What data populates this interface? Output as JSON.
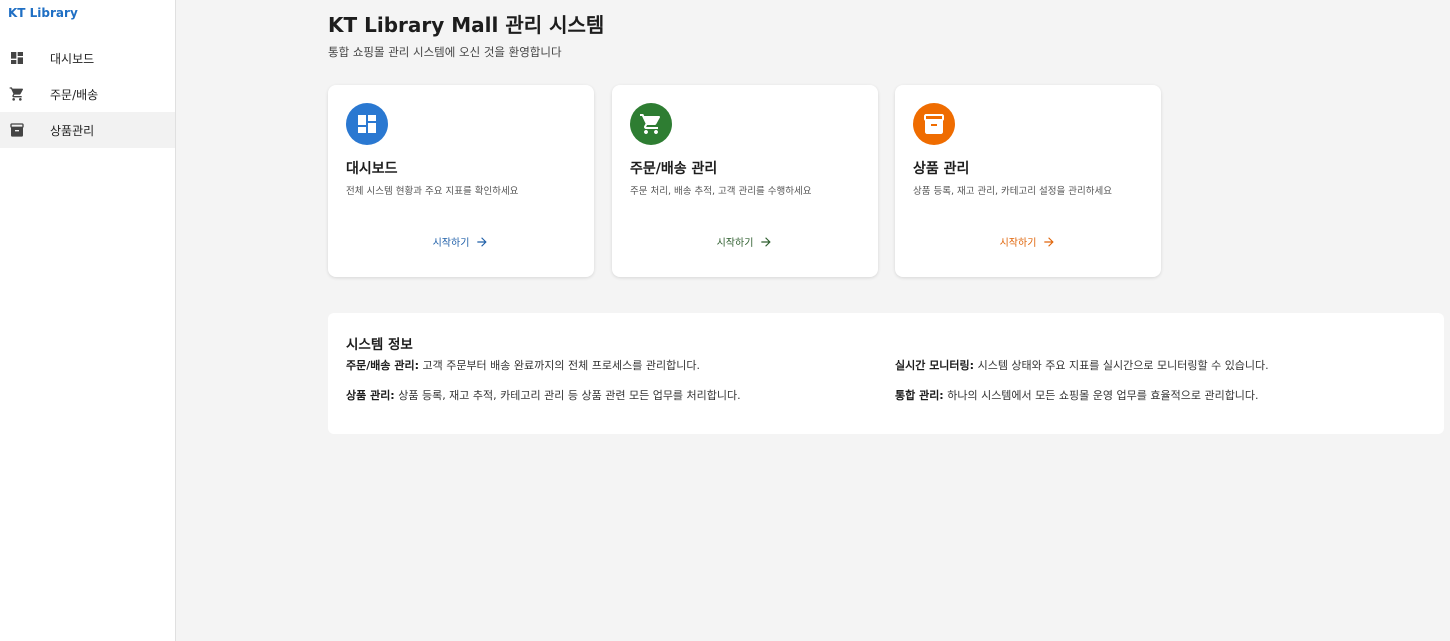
{
  "app": {
    "brand": "KT Library"
  },
  "sidebar": {
    "items": [
      {
        "label": "대시보드",
        "icon": "dashboard-icon",
        "active": false
      },
      {
        "label": "주문/배송",
        "icon": "cart-icon",
        "active": false
      },
      {
        "label": "상품관리",
        "icon": "archive-icon",
        "active": true
      }
    ]
  },
  "header": {
    "title": "KT Library Mall 관리 시스템",
    "subtitle": "통합 쇼핑몰 관리 시스템에 오신 것을 환영합니다"
  },
  "cards": [
    {
      "title": "대시보드",
      "description": "전체 시스템 현황과 주요 지표를 확인하세요",
      "action": "시작하기",
      "icon": "dashboard-icon",
      "color": "#2a78d1",
      "action_color": "#1f5fa8"
    },
    {
      "title": "주문/배송 관리",
      "description": "주문 처리, 배송 추적, 고객 관리를 수행하세요",
      "action": "시작하기",
      "icon": "cart-icon",
      "color": "#2e7d32",
      "action_color": "#2e5e2e"
    },
    {
      "title": "상품 관리",
      "description": "상품 등록, 재고 관리, 카테고리 설정을 관리하세요",
      "action": "시작하기",
      "icon": "archive-icon",
      "color": "#ef6c00",
      "action_color": "#e0650a"
    }
  ],
  "system_info": {
    "title": "시스템 정보",
    "items": [
      {
        "label": "주문/배송 관리:",
        "text": " 고객 주문부터 배송 완료까지의 전체 프로세스를 관리합니다."
      },
      {
        "label": "실시간 모니터링:",
        "text": " 시스템 상태와 주요 지표를 실시간으로 모니터링할 수 있습니다."
      },
      {
        "label": "상품 관리:",
        "text": " 상품 등록, 재고 추적, 카테고리 관리 등 상품 관련 모든 업무를 처리합니다."
      },
      {
        "label": "통합 관리:",
        "text": " 하나의 시스템에서 모든 쇼핑몰 운영 업무를 효율적으로 관리합니다."
      }
    ]
  }
}
